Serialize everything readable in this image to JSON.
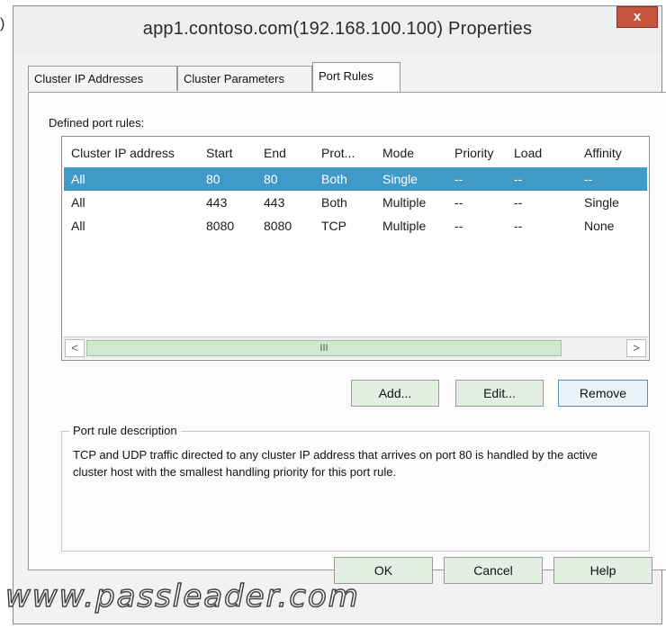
{
  "edge_glyph": ")",
  "window": {
    "title": "app1.contoso.com(192.168.100.100) Properties",
    "close_label": "x"
  },
  "tabs": [
    {
      "label": "Cluster IP Addresses",
      "active": false
    },
    {
      "label": "Cluster Parameters",
      "active": false
    },
    {
      "label": "Port Rules",
      "active": true
    }
  ],
  "port_rules": {
    "section_label": "Defined port rules:",
    "columns": [
      "Cluster IP address",
      "Start",
      "End",
      "Prot...",
      "Mode",
      "Priority",
      "Load",
      "Affinity"
    ],
    "rows": [
      {
        "cells": [
          "All",
          "80",
          "80",
          "Both",
          "Single",
          "--",
          "--",
          "--"
        ],
        "selected": true
      },
      {
        "cells": [
          "All",
          "443",
          "443",
          "Both",
          "Multiple",
          "--",
          "--",
          "Single"
        ],
        "selected": false
      },
      {
        "cells": [
          "All",
          "8080",
          "8080",
          "TCP",
          "Multiple",
          "--",
          "--",
          "None"
        ],
        "selected": false
      }
    ],
    "scroll_left": "<",
    "scroll_right": ">",
    "scroll_thumb": "III"
  },
  "buttons": {
    "add": "Add...",
    "edit": "Edit...",
    "remove": "Remove",
    "ok": "OK",
    "cancel": "Cancel",
    "help": "Help"
  },
  "description": {
    "title": "Port rule description",
    "text": "TCP and UDP traffic directed to any cluster IP address that arrives on port 80 is handled by the active cluster host with the smallest handling priority for this port rule."
  },
  "watermark": "www.passleader.com"
}
